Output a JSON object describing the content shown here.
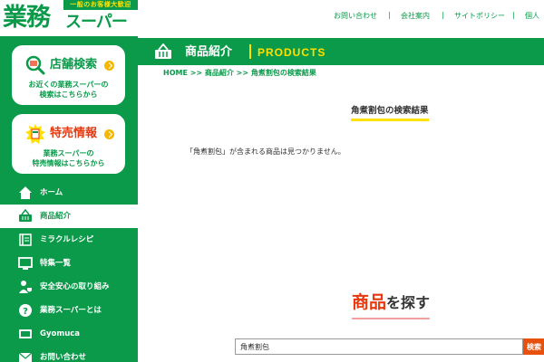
{
  "logo": {
    "tagline": "一般のお客様大歓迎",
    "name_main": "業務",
    "name_sub": "スーパー"
  },
  "store_card": {
    "title": "店舗検索",
    "text_line1": "お近くの業務スーパーの",
    "text_line2": "検索はこちらから"
  },
  "sale_card": {
    "title": "特売情報",
    "text_line1": "業務スーパーの",
    "text_line2": "特売情報はこちらから"
  },
  "nav": {
    "items": [
      {
        "label": "ホーム",
        "icon": "home-icon"
      },
      {
        "label": "商品紹介",
        "icon": "basket-icon",
        "active": true
      },
      {
        "label": "ミラクルレシピ",
        "icon": "recipe-icon"
      },
      {
        "label": "特集一覧",
        "icon": "monitor-icon"
      },
      {
        "label": "安全安心の取り組み",
        "icon": "safety-icon"
      },
      {
        "label": "業務スーパーとは",
        "icon": "question-icon"
      },
      {
        "label": "Gyomuca",
        "icon": "gyomuca-icon"
      },
      {
        "label": "お問い合わせ",
        "icon": "mail-icon"
      }
    ]
  },
  "header": {
    "links": [
      "お問い合わせ",
      "会社案内",
      "サイトポリシー",
      "個人"
    ]
  },
  "section": {
    "title": "商品紹介",
    "title_en": "PRODUCTS"
  },
  "breadcrumb": "HOME >> 商品紹介 >> 角煮割包の検索結果",
  "result": {
    "heading": "角煮割包の検索結果",
    "message": "「角煮割包」が含まれる商品は見つかりません。"
  },
  "find": {
    "heading_red": "商品",
    "heading_dark": "を探す"
  },
  "search": {
    "value": "角煮割包",
    "button_label": "検索"
  },
  "colors": {
    "brand_green": "#0a9a4a",
    "accent_yellow": "#ffe100",
    "accent_red": "#e8380d"
  }
}
